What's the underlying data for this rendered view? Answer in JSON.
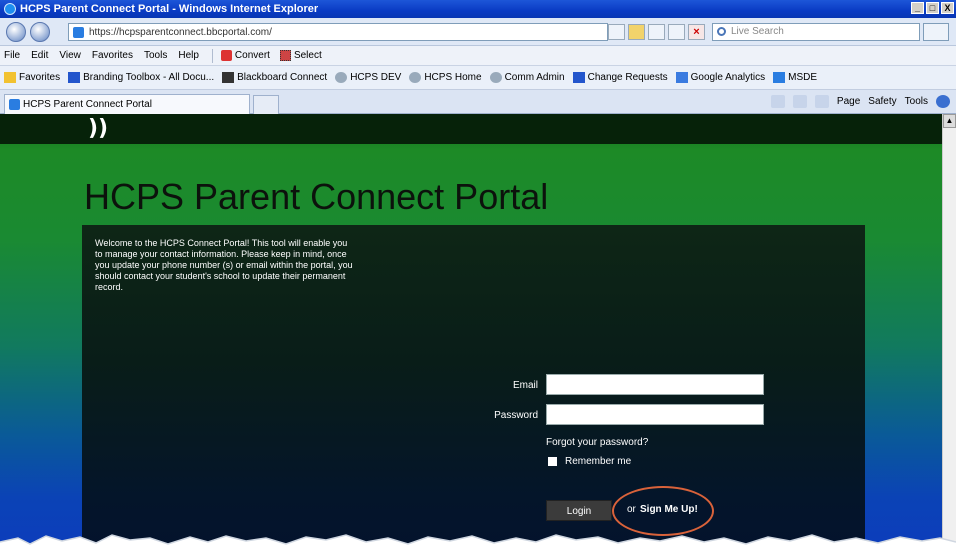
{
  "window": {
    "title": "HCPS Parent Connect Portal - Windows Internet Explorer",
    "buttons": [
      "_",
      "□",
      "X"
    ]
  },
  "address_bar": {
    "url": "https://hcpsparentconnect.bbcportal.com/",
    "search_placeholder": "Live Search"
  },
  "menu": {
    "items": [
      "File",
      "Edit",
      "View",
      "Favorites",
      "Tools",
      "Help"
    ],
    "convert_label": "Convert",
    "select_label": "Select"
  },
  "favorites_bar": {
    "favorites_label": "Favorites",
    "links": [
      "Branding Toolbox - All Docu...",
      "Blackboard Connect",
      "HCPS DEV",
      "HCPS Home",
      "Comm Admin",
      "Change Requests",
      "Google Analytics",
      "MSDE"
    ]
  },
  "tabs": {
    "active_tab": "HCPS Parent Connect Portal",
    "commands": [
      "Page",
      "Safety",
      "Tools"
    ]
  },
  "page": {
    "logo": "))",
    "title": "HCPS Parent Connect Portal",
    "welcome": "Welcome to the HCPS Connect Portal! This tool will enable you to manage your contact information.  Please keep in mind, once you update your phone number (s) or email within the portal, you should contact your student's school to update their permanent record.",
    "email_label": "Email",
    "password_label": "Password",
    "forgot_link": "Forgot your password?",
    "remember_label": "Remember me",
    "login_button": "Login",
    "or_text": "or",
    "signup_link": "Sign Me Up!"
  },
  "colors": {
    "page_green": "#1d8a26",
    "page_blue": "#0c3bbd",
    "panel_dark": "#091d18",
    "annotation_ring": "#d9623a"
  }
}
